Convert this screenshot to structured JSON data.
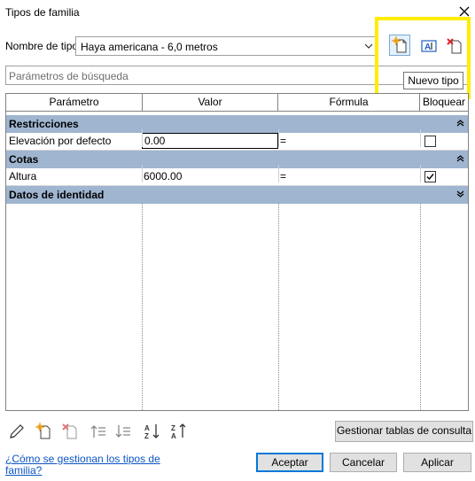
{
  "window": {
    "title": "Tipos de familia",
    "close_label": "✕"
  },
  "type_row": {
    "label": "Nombre de tipo:",
    "selected": "Haya americana - 6,0 metros",
    "tooltip": "Nuevo tipo"
  },
  "search": {
    "placeholder": "Parámetros de búsqueda"
  },
  "grid": {
    "columns": [
      "Parámetro",
      "Valor",
      "Fórmula",
      "Bloquear"
    ],
    "groups": [
      {
        "name": "Restricciones",
        "expanded": true,
        "rows": [
          {
            "param": "Elevación por defecto",
            "value": "0.00",
            "formula": "=",
            "locked": false
          }
        ]
      },
      {
        "name": "Cotas",
        "expanded": true,
        "rows": [
          {
            "param": "Altura",
            "value": "6000.00",
            "formula": "=",
            "locked": true
          }
        ]
      },
      {
        "name": "Datos de identidad",
        "expanded": false,
        "rows": []
      }
    ]
  },
  "buttons": {
    "lookup": "Gestionar tablas de consulta",
    "ok": "Aceptar",
    "cancel": "Cancelar",
    "apply": "Aplicar"
  },
  "help_link": "¿Cómo se gestionan los tipos de familia?",
  "colors": {
    "group_header": "#9fb5d0",
    "highlight": "#ffed00",
    "link": "#0b55c4",
    "primary_border": "#0078d7"
  }
}
